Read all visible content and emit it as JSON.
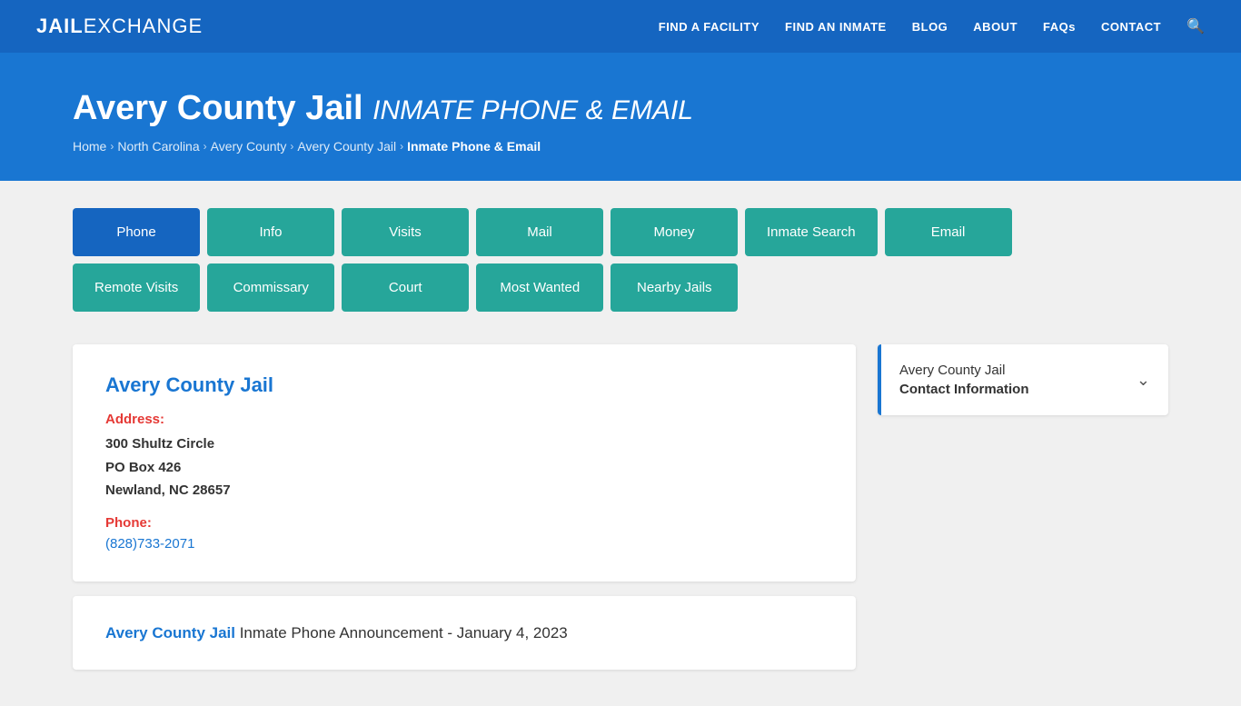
{
  "navbar": {
    "brand_jail": "JAIL",
    "brand_exchange": "EXCHANGE",
    "nav_items": [
      {
        "label": "FIND A FACILITY",
        "key": "find-facility"
      },
      {
        "label": "FIND AN INMATE",
        "key": "find-inmate"
      },
      {
        "label": "BLOG",
        "key": "blog"
      },
      {
        "label": "ABOUT",
        "key": "about"
      },
      {
        "label": "FAQs",
        "key": "faqs"
      },
      {
        "label": "CONTACT",
        "key": "contact"
      }
    ]
  },
  "hero": {
    "title_main": "Avery County Jail",
    "title_sub": "INMATE PHONE & EMAIL",
    "breadcrumbs": [
      {
        "label": "Home",
        "key": "home"
      },
      {
        "label": "North Carolina",
        "key": "nc"
      },
      {
        "label": "Avery County",
        "key": "avery-county"
      },
      {
        "label": "Avery County Jail",
        "key": "avery-jail"
      },
      {
        "label": "Inmate Phone & Email",
        "key": "current"
      }
    ]
  },
  "tabs": {
    "row1": [
      {
        "label": "Phone",
        "key": "phone",
        "active": true
      },
      {
        "label": "Info",
        "key": "info",
        "active": false
      },
      {
        "label": "Visits",
        "key": "visits",
        "active": false
      },
      {
        "label": "Mail",
        "key": "mail",
        "active": false
      },
      {
        "label": "Money",
        "key": "money",
        "active": false
      },
      {
        "label": "Inmate Search",
        "key": "inmate-search",
        "active": false
      },
      {
        "label": "Email",
        "key": "email",
        "active": false
      }
    ],
    "row2": [
      {
        "label": "Remote Visits",
        "key": "remote-visits",
        "active": false
      },
      {
        "label": "Commissary",
        "key": "commissary",
        "active": false
      },
      {
        "label": "Court",
        "key": "court",
        "active": false
      },
      {
        "label": "Most Wanted",
        "key": "most-wanted",
        "active": false
      },
      {
        "label": "Nearby Jails",
        "key": "nearby-jails",
        "active": false
      }
    ]
  },
  "info_card": {
    "title": "Avery County Jail",
    "address_label": "Address:",
    "address_line1": "300 Shultz Circle",
    "address_line2": "PO Box 426",
    "address_line3": "Newland, NC 28657",
    "phone_label": "Phone:",
    "phone_number": "(828)733-2071"
  },
  "announcement": {
    "link_text": "Avery County Jail",
    "rest_text": " Inmate Phone Announcement - January 4, 2023"
  },
  "sidebar": {
    "line1": "Avery County Jail",
    "line2": "Contact Information"
  }
}
